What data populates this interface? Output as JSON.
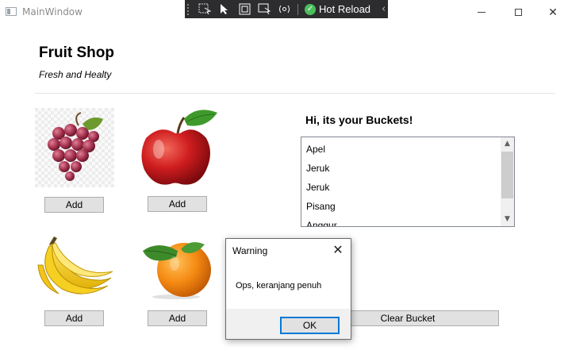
{
  "window": {
    "title": "MainWindow",
    "minimize_glyph": "",
    "maximize_glyph": "",
    "close_glyph": "✕"
  },
  "hot_reload_toolbar": {
    "label": "Hot Reload",
    "check_glyph": "✓",
    "collapse_glyph": "‹"
  },
  "header": {
    "title": "Fruit Shop",
    "subtitle": "Fresh and Healty"
  },
  "fruits": [
    {
      "name": "grapes",
      "icon": "grapes-image",
      "button_label": "Add"
    },
    {
      "name": "apple",
      "icon": "apple-image",
      "button_label": "Add"
    },
    {
      "name": "banana",
      "icon": "banana-image",
      "button_label": "Add"
    },
    {
      "name": "orange",
      "icon": "orange-image",
      "button_label": "Add"
    }
  ],
  "bucket": {
    "title": "Hi, its your Buckets!",
    "items": [
      "Apel",
      "Jeruk",
      "Jeruk",
      "Pisang",
      "Anggur"
    ],
    "scroll_up_glyph": "▲",
    "scroll_down_glyph": "▼",
    "clear_label": "Clear Bucket"
  },
  "dialog": {
    "title": "Warning",
    "close_glyph": "✕",
    "message": "Ops, keranjang penuh",
    "ok_label": "OK"
  },
  "colors": {
    "accent": "#0078d7",
    "button_bg": "#e1e1e1",
    "button_border": "#adadad",
    "toolbar_bg": "#2d2d30",
    "hot_reload_green": "#4bbf5b"
  }
}
